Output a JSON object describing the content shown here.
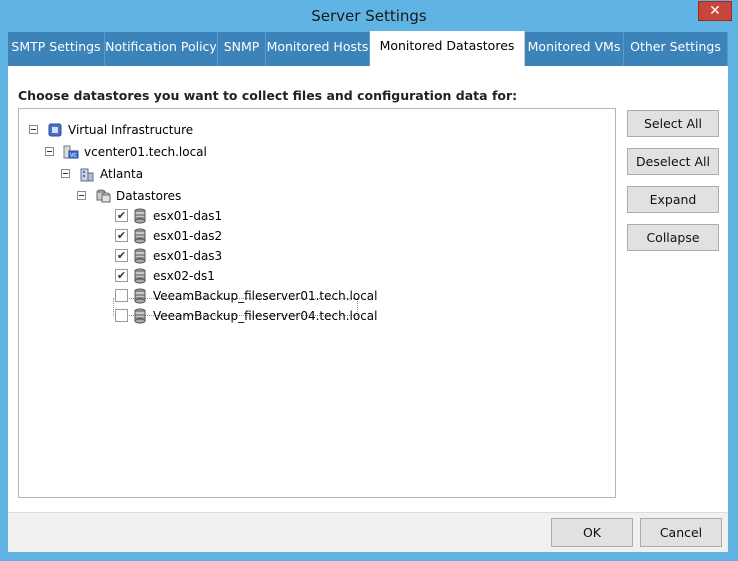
{
  "window": {
    "title": "Server Settings",
    "close_glyph": "✕"
  },
  "tabs": [
    {
      "label": "SMTP Settings"
    },
    {
      "label": "Notification Policy"
    },
    {
      "label": "SNMP"
    },
    {
      "label": "Monitored Hosts"
    },
    {
      "label": "Monitored Datastores",
      "active": true
    },
    {
      "label": "Monitored VMs"
    },
    {
      "label": "Other Settings"
    }
  ],
  "content": {
    "prompt": "Choose datastores you want to collect files and configuration data for:"
  },
  "tree": {
    "root": {
      "label": "Virtual Infrastructure",
      "icon": "virtual-infrastructure-icon"
    },
    "vcenter": {
      "label": "vcenter01.tech.local",
      "icon": "vcenter-icon"
    },
    "datacenter": {
      "label": "Atlanta",
      "icon": "datacenter-icon"
    },
    "folder": {
      "label": "Datastores",
      "icon": "datastores-folder-icon"
    },
    "datastores": [
      {
        "label": "esx01-das1",
        "checked": true
      },
      {
        "label": "esx01-das2",
        "checked": true
      },
      {
        "label": "esx01-das3",
        "checked": true
      },
      {
        "label": "esx02-ds1",
        "checked": true
      },
      {
        "label": "VeeamBackup_fileserver01.tech.local",
        "checked": false,
        "selected": true
      },
      {
        "label": "VeeamBackup_fileserver04.tech.local",
        "checked": false
      }
    ],
    "check_glyph": "✔"
  },
  "side_buttons": {
    "select_all": "Select All",
    "deselect_all": "Deselect All",
    "expand": "Expand",
    "collapse": "Collapse"
  },
  "footer": {
    "ok": "OK",
    "cancel": "Cancel"
  },
  "colors": {
    "titlebar": "#5fb4e4",
    "tabstrip": "#3c83b9",
    "close": "#c7463c"
  }
}
